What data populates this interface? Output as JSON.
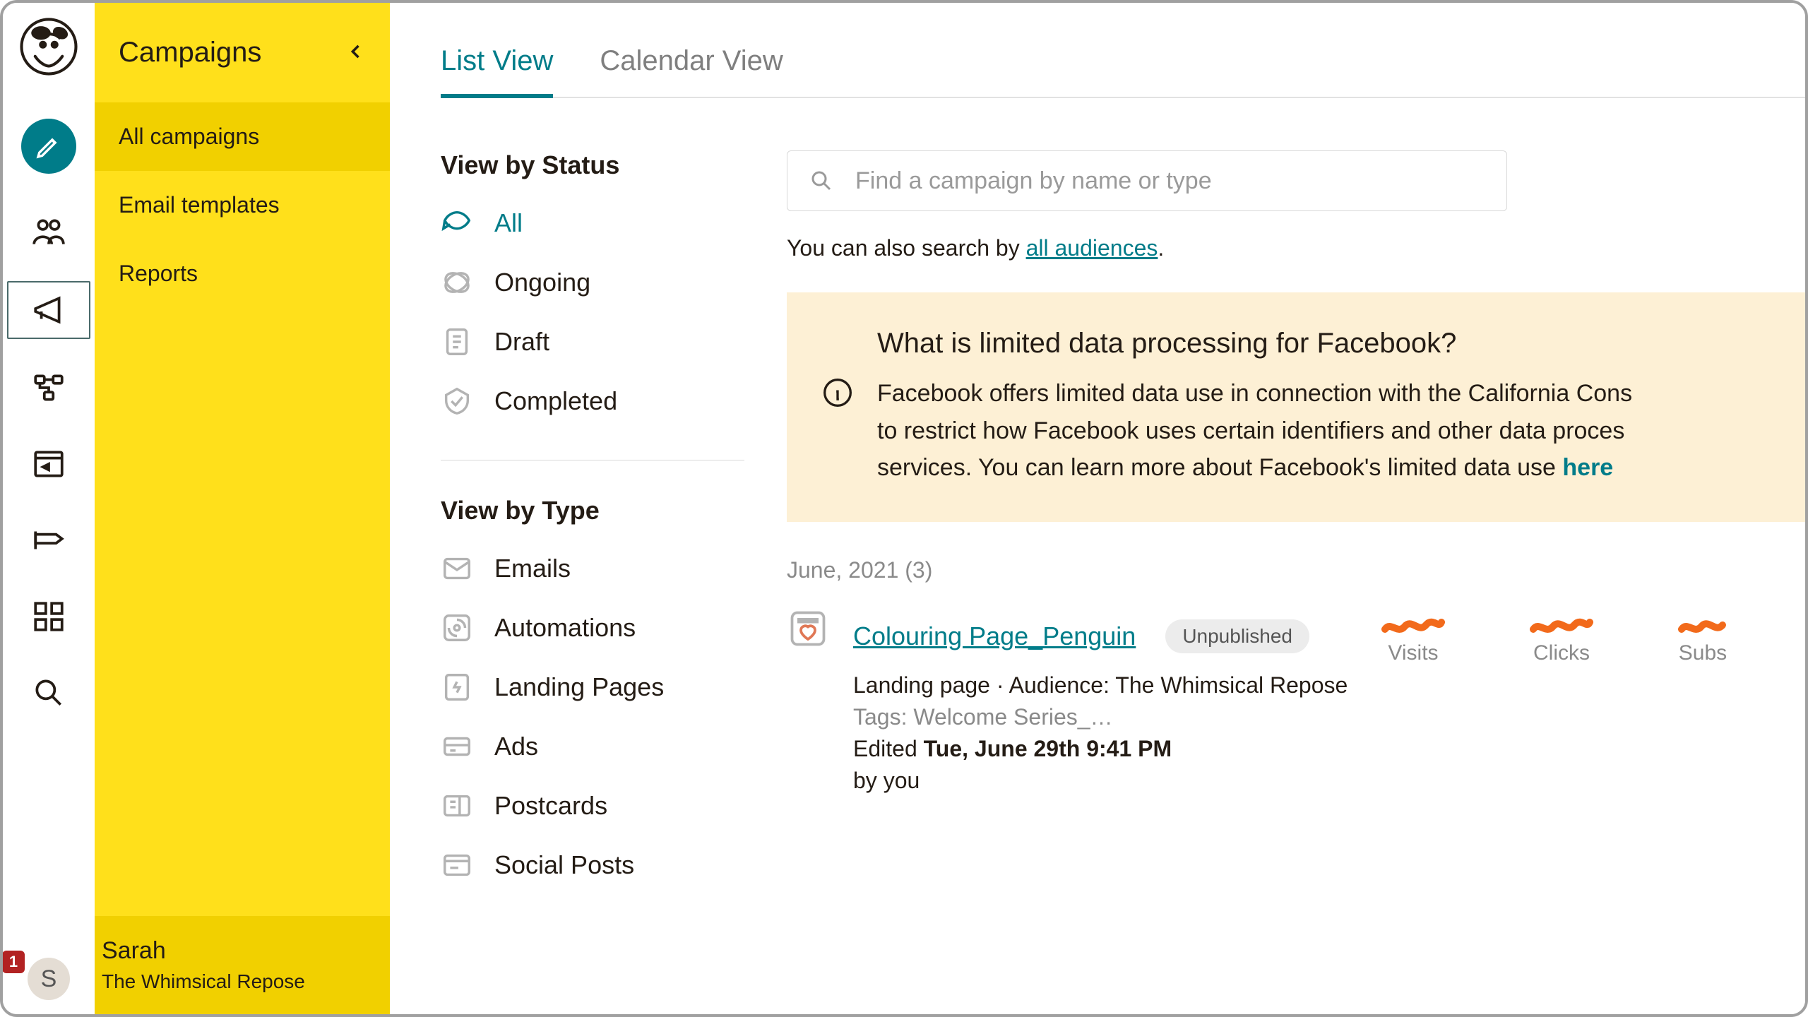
{
  "iconbar": {
    "avatar_letter": "S",
    "avatar_badge": "1"
  },
  "subnav": {
    "title": "Campaigns",
    "items": [
      {
        "label": "All campaigns",
        "active": true
      },
      {
        "label": "Email templates",
        "active": false
      },
      {
        "label": "Reports",
        "active": false
      }
    ],
    "footer_name": "Sarah",
    "footer_org": "The Whimsical Repose"
  },
  "tabs": {
    "list": "List View",
    "calendar": "Calendar View"
  },
  "filters": {
    "status_heading": "View by Status",
    "status": [
      "All",
      "Ongoing",
      "Draft",
      "Completed"
    ],
    "type_heading": "View by Type",
    "type": [
      "Emails",
      "Automations",
      "Landing Pages",
      "Ads",
      "Postcards",
      "Social Posts"
    ]
  },
  "search": {
    "placeholder": "Find a campaign by name or type",
    "hint_prefix": "You can also search by ",
    "hint_link": "all audiences",
    "hint_suffix": "."
  },
  "notice": {
    "title": "What is limited data processing for Facebook?",
    "body_1": "Facebook offers limited data use in connection with the California Cons",
    "body_2": "to restrict how Facebook uses certain identifiers and other data proces",
    "body_3": "services. You can learn more about Facebook's limited data use ",
    "link": "here"
  },
  "list": {
    "month_header": "June, 2021 (3)",
    "campaign": {
      "title": "Colouring Page_Penguin",
      "badge": "Unpublished",
      "subtitle": "Landing page · Audience: The Whimsical Repose",
      "tags": "Tags: Welcome Series_…",
      "edited_prefix": "Edited ",
      "edited_date": "Tue, June 29th 9:41 PM",
      "by": "by you"
    },
    "stats": {
      "visits": "Visits",
      "clicks": "Clicks",
      "subs": "Subs"
    }
  }
}
